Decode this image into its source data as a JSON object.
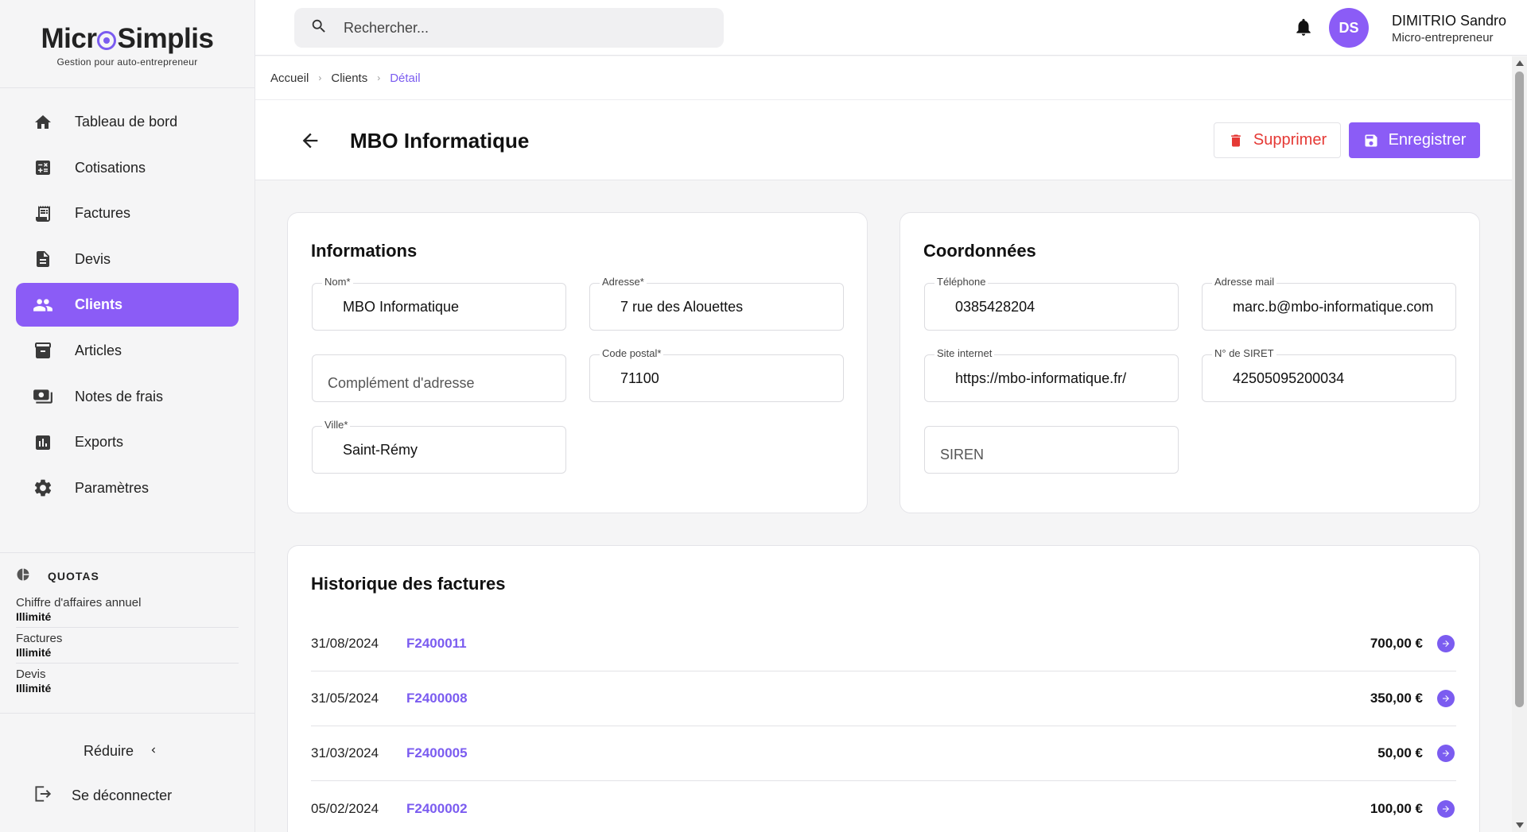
{
  "brand": {
    "name_part1": "Micr",
    "name_part2": "Simplis",
    "tagline": "Gestion pour auto-entrepreneur",
    "accent": "#8b5cf6"
  },
  "sidebar": {
    "items": [
      {
        "label": "Tableau de bord",
        "icon": "home-icon"
      },
      {
        "label": "Cotisations",
        "icon": "calculator-icon"
      },
      {
        "label": "Factures",
        "icon": "receipt-icon"
      },
      {
        "label": "Devis",
        "icon": "document-icon"
      },
      {
        "label": "Clients",
        "icon": "people-icon",
        "active": true
      },
      {
        "label": "Articles",
        "icon": "archive-icon"
      },
      {
        "label": "Notes de frais",
        "icon": "money-icon"
      },
      {
        "label": "Exports",
        "icon": "bar-chart-icon"
      },
      {
        "label": "Paramètres",
        "icon": "gear-icon"
      }
    ],
    "quotas": {
      "title": "QUOTAS",
      "rows": [
        {
          "label": "Chiffre d'affaires annuel",
          "value": "Illimité"
        },
        {
          "label": "Factures",
          "value": "Illimité"
        },
        {
          "label": "Devis",
          "value": "Illimité"
        }
      ]
    },
    "reduce_label": "Réduire",
    "logout_label": "Se déconnecter"
  },
  "topbar": {
    "search_placeholder": "Rechercher...",
    "avatar_initials": "DS",
    "user_name": "DIMITRIO Sandro",
    "user_role": "Micro-entrepreneur"
  },
  "breadcrumb": [
    "Accueil",
    "Clients",
    "Détail"
  ],
  "page": {
    "title": "MBO Informatique",
    "delete_label": "Supprimer",
    "save_label": "Enregistrer"
  },
  "informations": {
    "title": "Informations",
    "nom_label": "Nom*",
    "nom_value": "MBO Informatique",
    "adresse_label": "Adresse*",
    "adresse_value": "7 rue des Alouettes",
    "complement_placeholder": "Complément d'adresse",
    "cp_label": "Code postal*",
    "cp_value": "71100",
    "ville_label": "Ville*",
    "ville_value": "Saint-Rémy"
  },
  "coordonnees": {
    "title": "Coordonnées",
    "tel_label": "Téléphone",
    "tel_value": "0385428204",
    "mail_label": "Adresse mail",
    "mail_value": "marc.b@mbo-informatique.com",
    "site_label": "Site internet",
    "site_value": "https://mbo-informatique.fr/",
    "siret_label": "N° de SIRET",
    "siret_value": "42505095200034",
    "siren_placeholder": "SIREN"
  },
  "historique": {
    "title": "Historique des factures",
    "rows": [
      {
        "date": "31/08/2024",
        "ref": "F2400011",
        "amount": "700,00 €"
      },
      {
        "date": "31/05/2024",
        "ref": "F2400008",
        "amount": "350,00 €"
      },
      {
        "date": "31/03/2024",
        "ref": "F2400005",
        "amount": "50,00 €"
      },
      {
        "date": "05/02/2024",
        "ref": "F2400002",
        "amount": "100,00 €"
      }
    ]
  }
}
